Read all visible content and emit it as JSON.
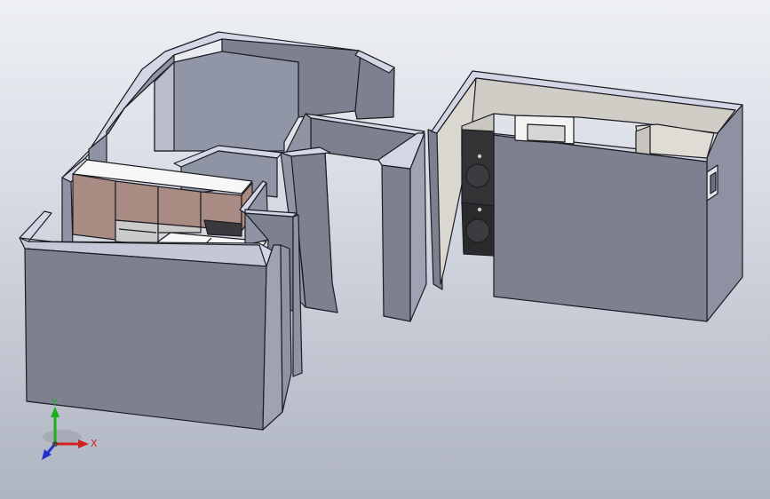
{
  "viewport": {
    "background_top": "#eef0f4",
    "background_bottom": "#aeb4c0"
  },
  "model": {
    "wall_face_color": "#7c808f",
    "wall_top_color": "#d4d6e6",
    "wall_inner_color": "#8f94a5",
    "room_interior_color": "#cfcdc6",
    "cabinet_color": "#a88b82",
    "countertop_color": "#f7f7f7",
    "appliance_color": "#333336"
  },
  "triad": {
    "x_label": "X",
    "y_label": "Y",
    "x_color": "#d21f1f",
    "y_color": "#19b019",
    "z_color": "#2233cc"
  }
}
